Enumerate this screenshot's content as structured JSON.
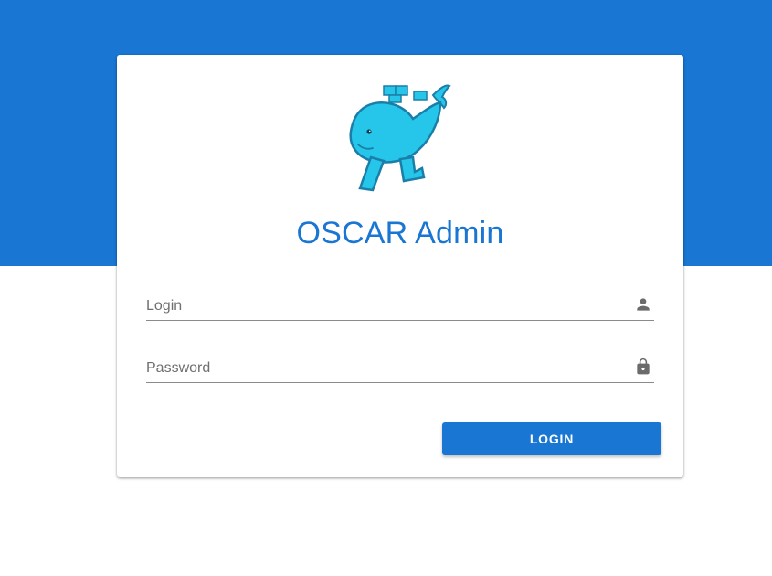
{
  "app": {
    "title": "OSCAR Admin",
    "accent_color": "#1976d2",
    "logo_icon": "whale-logo-icon"
  },
  "form": {
    "login": {
      "placeholder": "Login",
      "value": "",
      "icon": "person-icon"
    },
    "password": {
      "placeholder": "Password",
      "value": "",
      "icon": "lock-icon"
    },
    "submit_label": "LOGIN"
  }
}
